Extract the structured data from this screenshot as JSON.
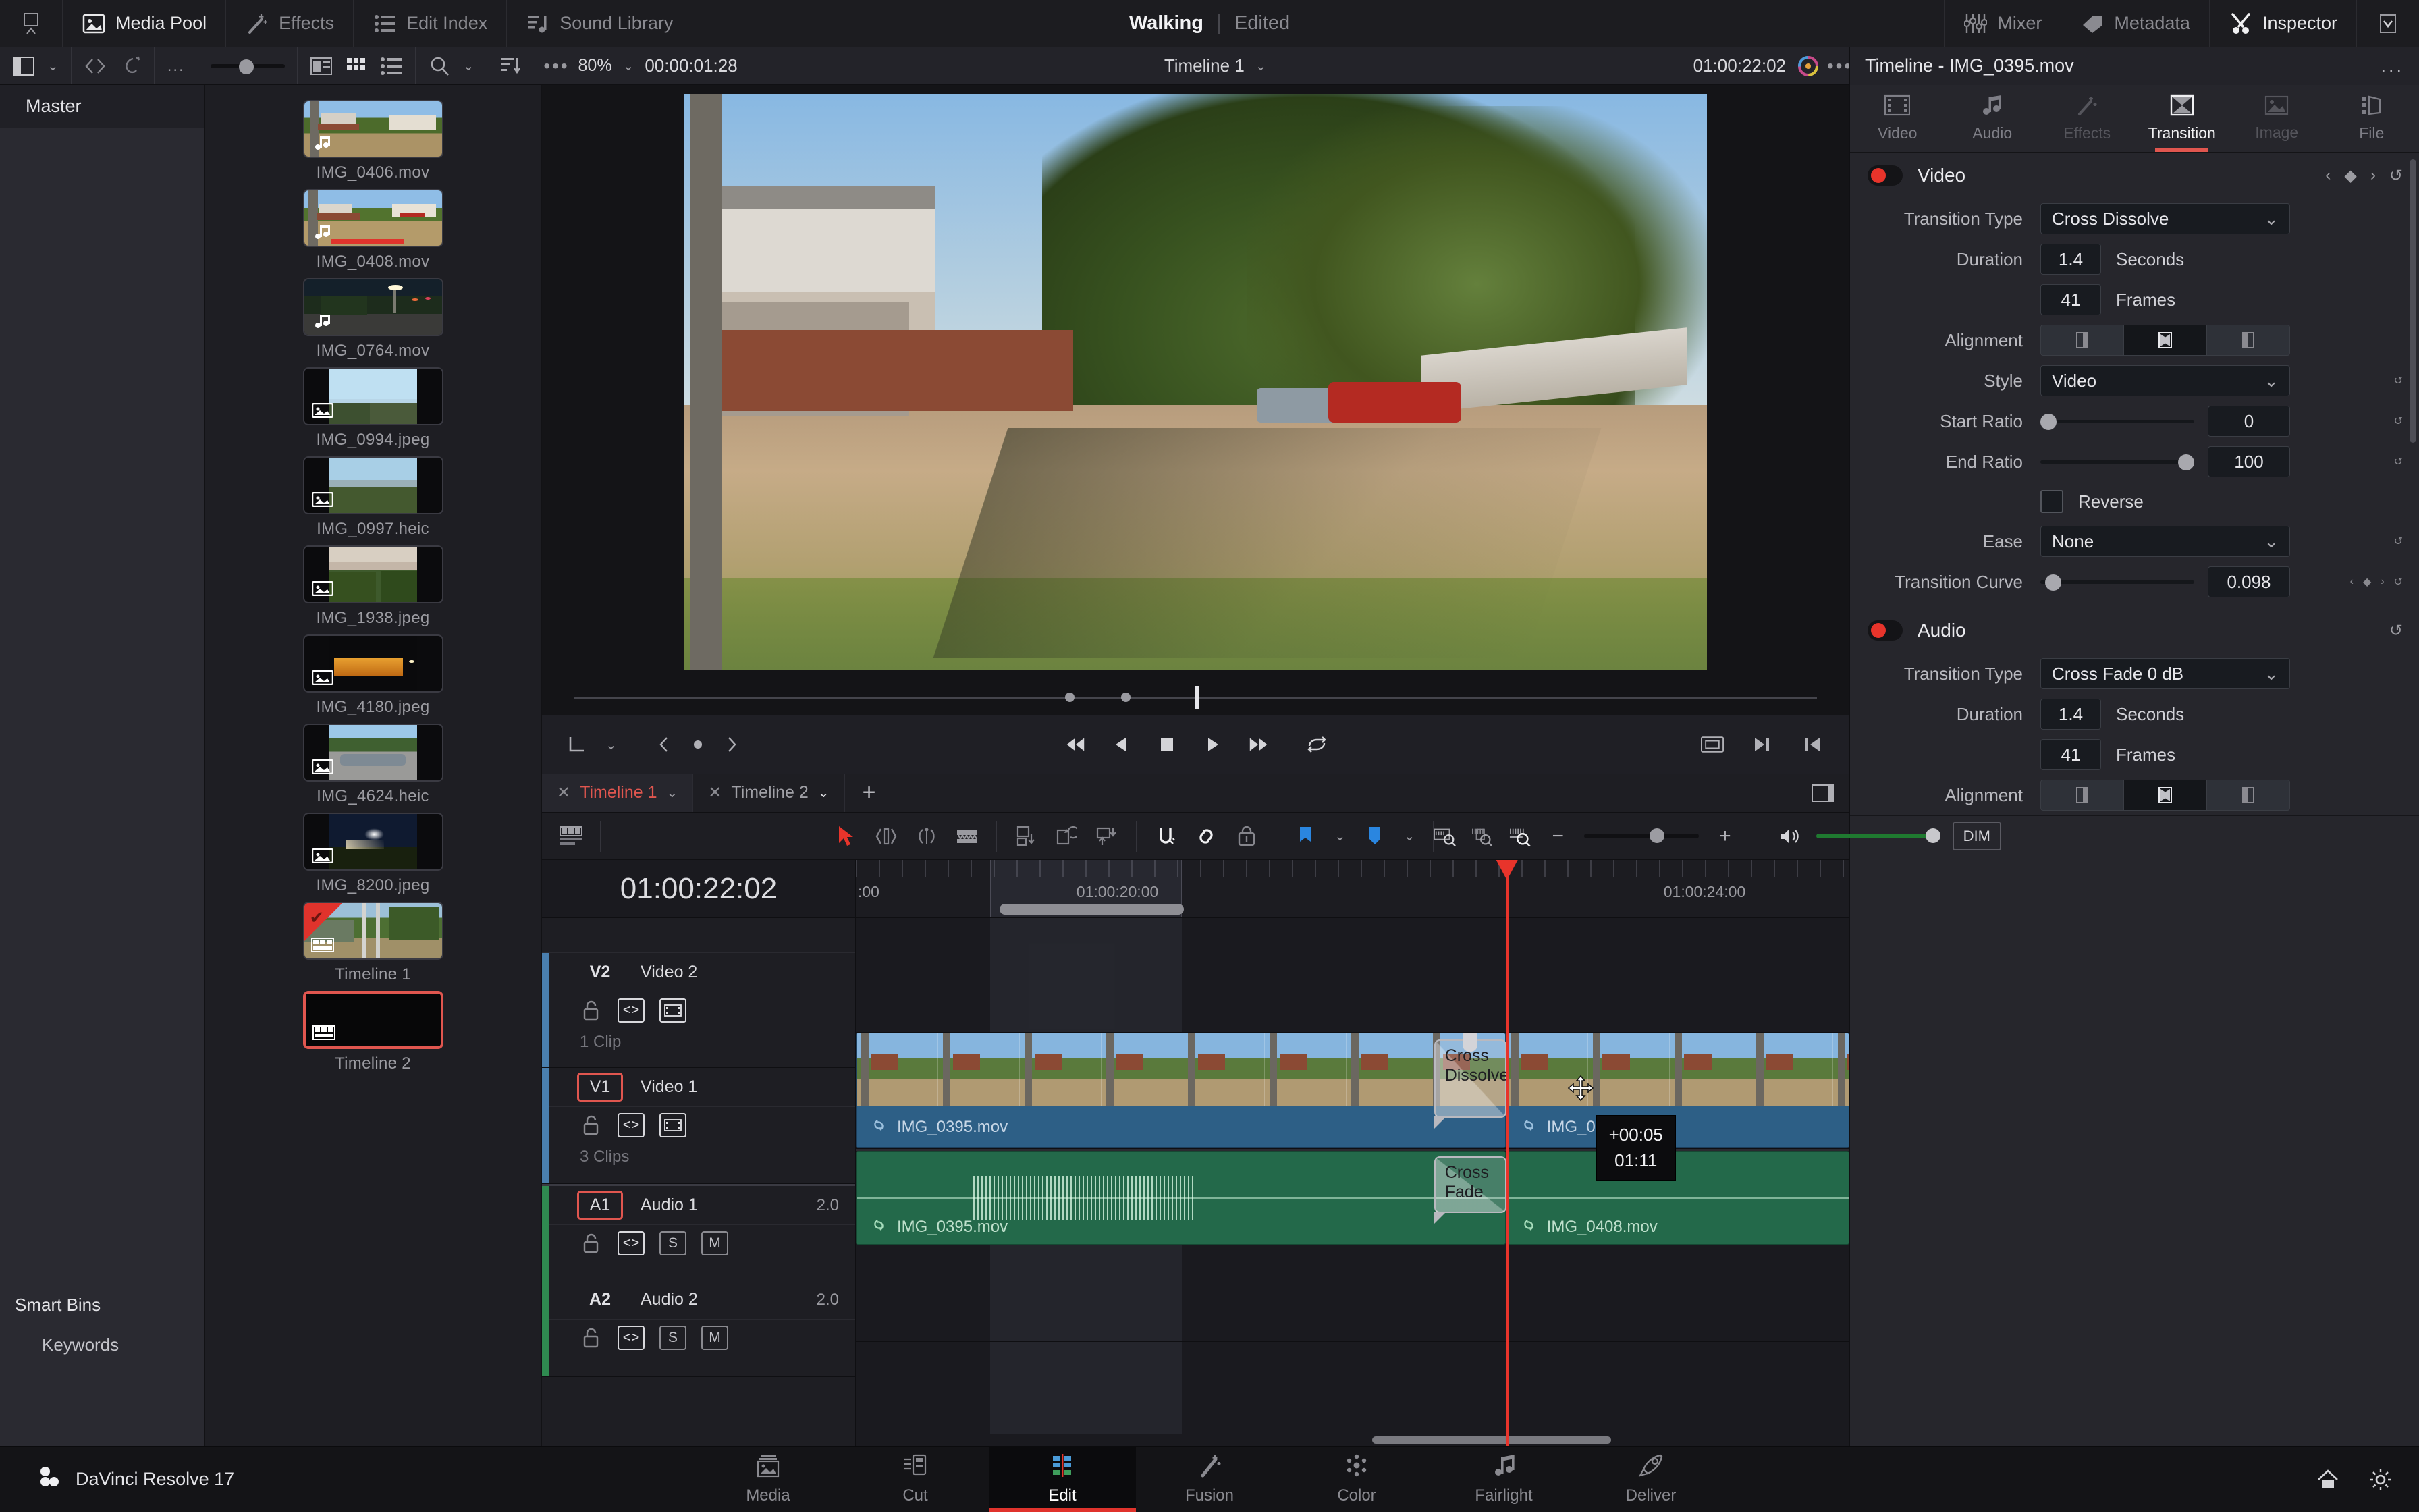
{
  "topbar": {
    "left_items": [
      {
        "icon": "panel-toggle-icon",
        "label": ""
      },
      {
        "icon": "media-pool-icon",
        "label": "Media Pool"
      },
      {
        "icon": "effects-wand-icon",
        "label": "Effects"
      },
      {
        "icon": "edit-index-icon",
        "label": "Edit Index"
      },
      {
        "icon": "sound-library-icon",
        "label": "Sound Library"
      }
    ],
    "project_name": "Walking",
    "project_state": "Edited",
    "right_items": [
      {
        "icon": "mixer-icon",
        "label": "Mixer"
      },
      {
        "icon": "metadata-icon",
        "label": "Metadata"
      },
      {
        "icon": "inspector-icon",
        "label": "Inspector"
      },
      {
        "icon": "chevron-down-icon",
        "label": ""
      }
    ]
  },
  "pool_toolbar": {
    "more_dots": "...",
    "search_icon": "search-icon",
    "sort_icon": "sort-icon",
    "options_icon": "options-dots-icon"
  },
  "viewer_bar": {
    "zoom_level": "80%",
    "source_timecode": "00:00:01:28",
    "viewer_title": "Timeline 1",
    "record_timecode": "01:00:22:02",
    "color_wheel_icon": "color-wheel-icon",
    "more_icon": "more-dots-icon"
  },
  "bins": {
    "master_label": "Master",
    "smart_bins_label": "Smart Bins",
    "keywords_label": "Keywords"
  },
  "media_pool": {
    "items": [
      {
        "name": "IMG_0406.mov",
        "kind": "audio-video",
        "selected": false
      },
      {
        "name": "IMG_0408.mov",
        "kind": "audio-video",
        "selected": false,
        "used": true
      },
      {
        "name": "IMG_0764.mov",
        "kind": "audio-video",
        "selected": false
      },
      {
        "name": "IMG_0994.jpeg",
        "kind": "still",
        "selected": false
      },
      {
        "name": "IMG_0997.heic",
        "kind": "still",
        "selected": false
      },
      {
        "name": "IMG_1938.jpeg",
        "kind": "still",
        "selected": false
      },
      {
        "name": "IMG_4180.jpeg",
        "kind": "still",
        "selected": false
      },
      {
        "name": "IMG_4624.heic",
        "kind": "still",
        "selected": false
      },
      {
        "name": "IMG_8200.jpeg",
        "kind": "still",
        "selected": false
      },
      {
        "name": "Timeline 1",
        "kind": "timeline",
        "selected": false,
        "flagged": true
      },
      {
        "name": "Timeline 2",
        "kind": "timeline",
        "selected": true
      }
    ]
  },
  "inspector": {
    "header_title": "Timeline - IMG_0395.mov",
    "header_more": "...",
    "tabs": [
      {
        "label": "Video",
        "icon": "film-strip-icon",
        "active": false,
        "enabled": true
      },
      {
        "label": "Audio",
        "icon": "music-note-icon",
        "active": false,
        "enabled": true
      },
      {
        "label": "Effects",
        "icon": "effects-wand-icon",
        "active": false,
        "enabled": false
      },
      {
        "label": "Transition",
        "icon": "transition-icon",
        "active": true,
        "enabled": true
      },
      {
        "label": "Image",
        "icon": "image-icon",
        "active": false,
        "enabled": false
      },
      {
        "label": "File",
        "icon": "file-icon",
        "active": false,
        "enabled": true
      }
    ],
    "video_section": {
      "title": "Video",
      "enabled_color": "#e8342b",
      "transition_type_label": "Transition Type",
      "transition_type_value": "Cross Dissolve",
      "duration_label": "Duration",
      "duration_seconds": "1.4",
      "seconds_unit": "Seconds",
      "duration_frames": "41",
      "frames_unit": "Frames",
      "alignment_label": "Alignment",
      "alignment_selected": 1,
      "style_label": "Style",
      "style_value": "Video",
      "start_ratio_label": "Start Ratio",
      "start_ratio_value": "0",
      "end_ratio_label": "End Ratio",
      "end_ratio_value": "100",
      "reverse_label": "Reverse",
      "reverse_checked": false,
      "ease_label": "Ease",
      "ease_value": "None",
      "transition_curve_label": "Transition Curve",
      "transition_curve_value": "0.098"
    },
    "audio_section": {
      "title": "Audio",
      "transition_type_label": "Transition Type",
      "transition_type_value": "Cross Fade 0 dB",
      "duration_label": "Duration",
      "duration_seconds": "1.4",
      "seconds_unit": "Seconds",
      "duration_frames": "41",
      "frames_unit": "Frames",
      "alignment_label": "Alignment",
      "alignment_selected": 1
    }
  },
  "timeline": {
    "tabs": [
      {
        "label": "Timeline 1",
        "active": true
      },
      {
        "label": "Timeline 2",
        "active": false
      }
    ],
    "add_tab": "+",
    "playhead_timecode": "01:00:22:02",
    "ruler_labels": [
      ":00",
      "01:00:20:00",
      "01:00:24:00"
    ],
    "tracks": [
      {
        "id": "V2",
        "name": "Video 2",
        "clip_count": "1 Clip",
        "armed": false,
        "type": "video"
      },
      {
        "id": "V1",
        "name": "Video 1",
        "clip_count": "3 Clips",
        "armed": true,
        "type": "video"
      },
      {
        "id": "A1",
        "name": "Audio 1",
        "channels": "2.0",
        "armed": true,
        "type": "audio"
      },
      {
        "id": "A2",
        "name": "Audio 2",
        "channels": "2.0",
        "armed": false,
        "type": "audio"
      }
    ],
    "video_clips": [
      {
        "name": "IMG_0395.mov"
      },
      {
        "name": "IMG_0408.mov"
      }
    ],
    "audio_clips": [
      {
        "name": "IMG_0395.mov"
      },
      {
        "name": "IMG_0408.mov"
      }
    ],
    "video_transition_label": "Cross Dissolve",
    "audio_transition_label": "Cross Fade",
    "drag_tooltip_offset": "+00:05",
    "drag_tooltip_duration": "01:11",
    "toolbar": {
      "zoom_minus": "−",
      "zoom_plus": "+",
      "dim_label": "DIM"
    }
  },
  "bottom": {
    "brand": "DaVinci Resolve 17",
    "pages": [
      {
        "label": "Media",
        "icon": "media-page-icon",
        "active": false
      },
      {
        "label": "Cut",
        "icon": "cut-page-icon",
        "active": false
      },
      {
        "label": "Edit",
        "icon": "edit-page-icon",
        "active": true
      },
      {
        "label": "Fusion",
        "icon": "fusion-page-icon",
        "active": false
      },
      {
        "label": "Color",
        "icon": "color-page-icon",
        "active": false
      },
      {
        "label": "Fairlight",
        "icon": "fairlight-page-icon",
        "active": false
      },
      {
        "label": "Deliver",
        "icon": "deliver-page-icon",
        "active": false
      }
    ],
    "home_icon": "home-icon",
    "settings_icon": "gear-icon"
  }
}
